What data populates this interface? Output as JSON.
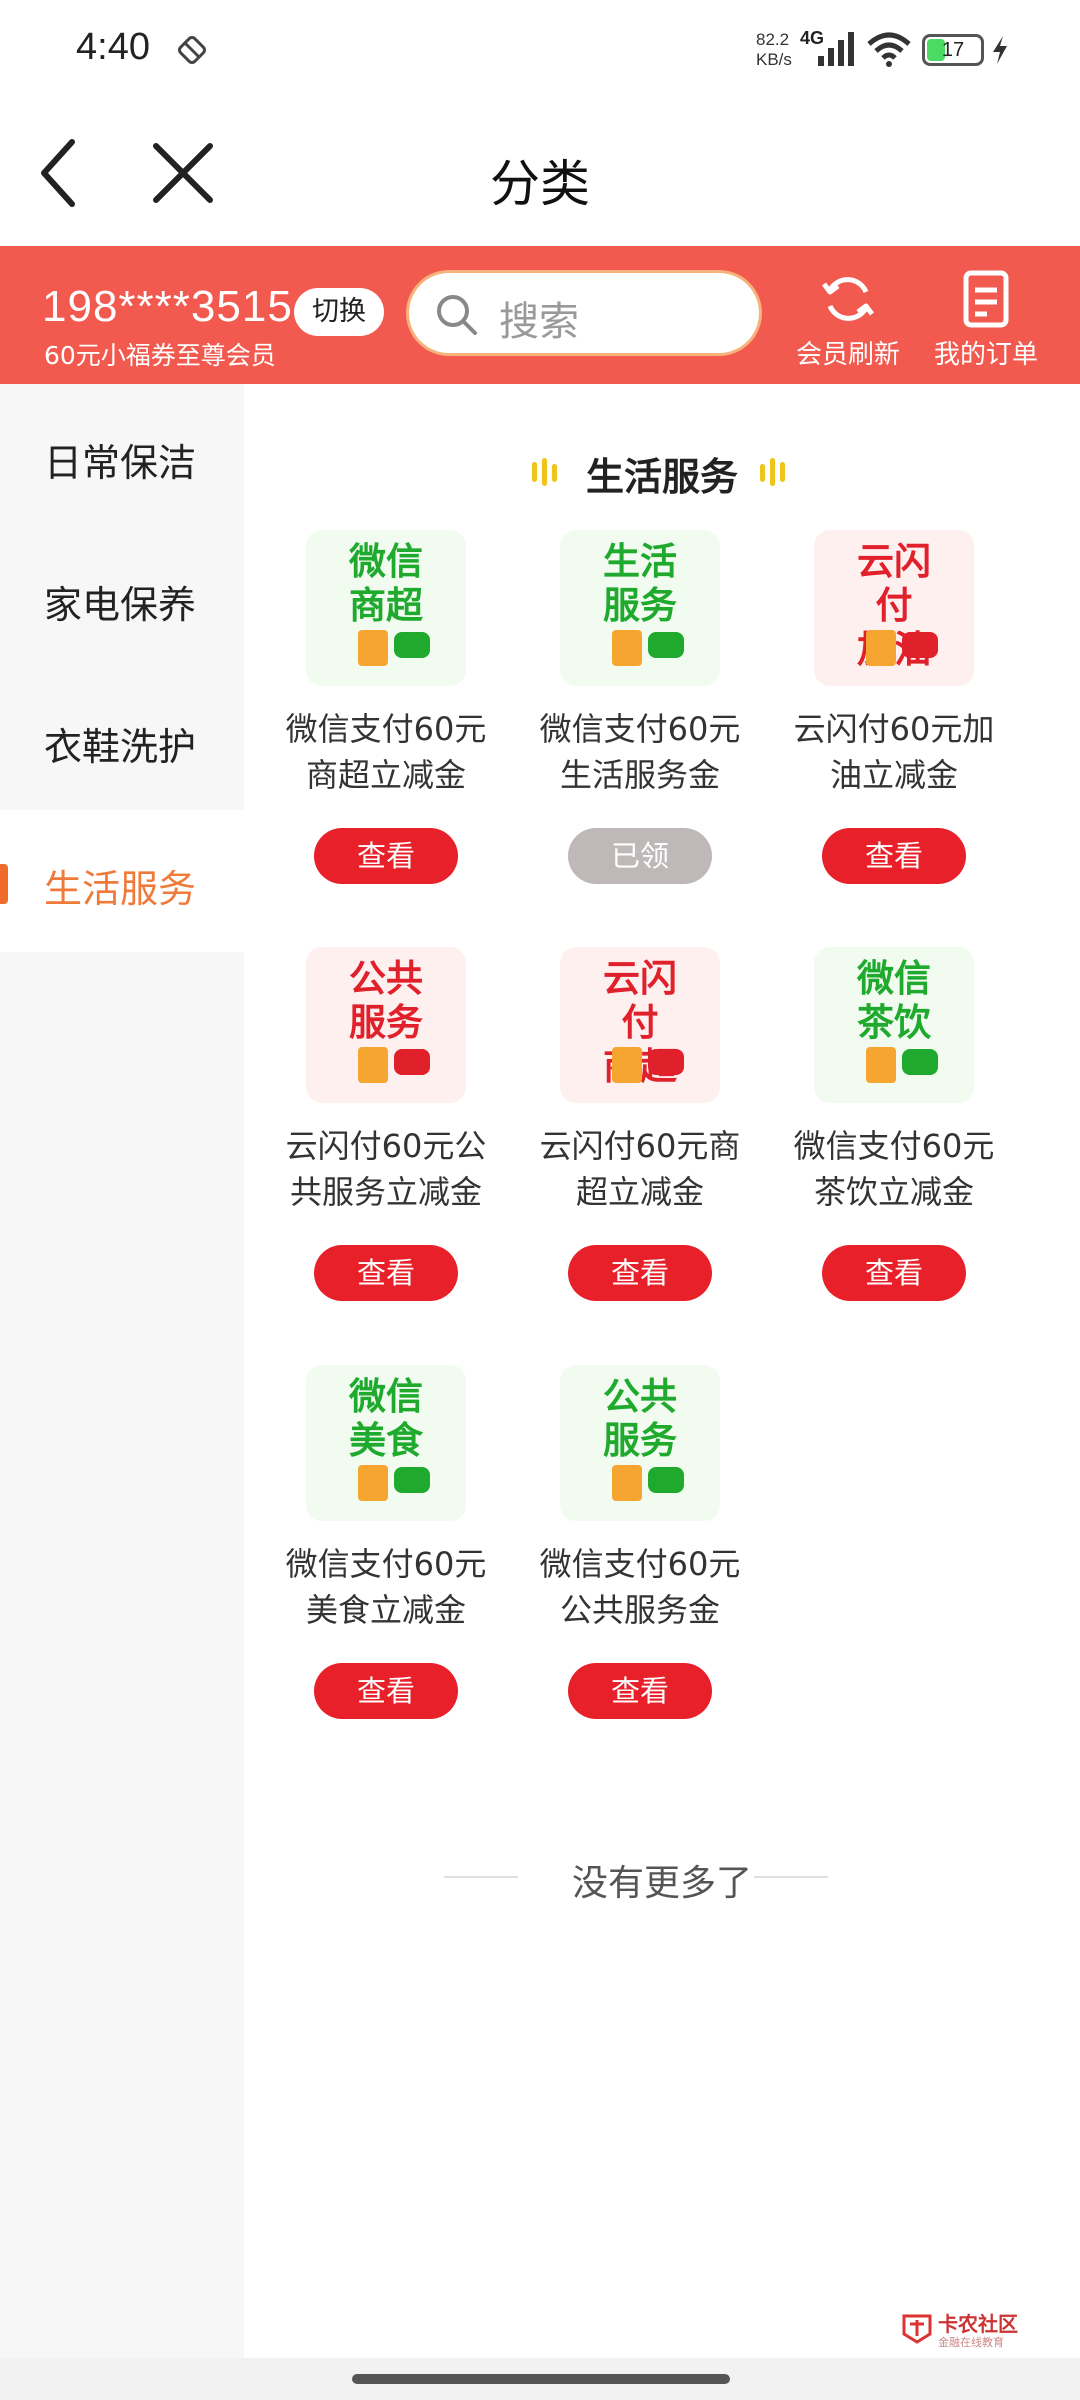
{
  "status_bar": {
    "time": "4:40",
    "speed_value": "82.2",
    "speed_unit": "KB/s",
    "network": "4G",
    "battery": "17"
  },
  "nav": {
    "title": "分类"
  },
  "header": {
    "phone": "198****3515",
    "member_text": "60元小福券至尊会员",
    "switch_label": "切换",
    "search_placeholder": "搜索",
    "refresh_label": "会员刷新",
    "orders_label": "我的订单"
  },
  "sidebar": {
    "items": [
      {
        "label": "日常保洁",
        "active": false
      },
      {
        "label": "家电保养",
        "active": false
      },
      {
        "label": "衣鞋洗护",
        "active": false
      },
      {
        "label": "生活服务",
        "active": true
      }
    ]
  },
  "section": {
    "title": "生活服务"
  },
  "cards": [
    {
      "thumb_text": "微信商超",
      "name": "微信支付60元商超立减金",
      "button": "查看",
      "brand": "wechat"
    },
    {
      "thumb_text": "生活服务",
      "name": "微信支付60元生活服务金",
      "button": "已领",
      "brand": "wechat"
    },
    {
      "thumb_text": "云闪付加油",
      "name": "云闪付60元加油立减金",
      "button": "查看",
      "brand": "unionpay"
    },
    {
      "thumb_text": "公共服务",
      "name": "云闪付60元公共服务立减金",
      "button": "查看",
      "brand": "unionpay"
    },
    {
      "thumb_text": "云闪付商超",
      "name": "云闪付60元商超立减金",
      "button": "查看",
      "brand": "unionpay"
    },
    {
      "thumb_text": "微信茶饮",
      "name": "微信支付60元茶饮立减金",
      "button": "查看",
      "brand": "wechat"
    },
    {
      "thumb_text": "微信美食",
      "name": "微信支付60元美食立减金",
      "button": "查看",
      "brand": "wechat"
    },
    {
      "thumb_text": "公共服务",
      "name": "微信支付60元公共服务金",
      "button": "查看",
      "brand": "wechat"
    }
  ],
  "no_more_text": "没有更多了",
  "watermark": {
    "line1": "卡农社区",
    "line2": "金融在线教育"
  },
  "colors": {
    "header_red": "#f25a50",
    "button_red": "#e8202a",
    "button_claimed": "#bfb8b8",
    "wechat_green": "#1faa2e",
    "unionpay_red": "#e0202a",
    "active_orange": "#f07a3a"
  },
  "icons": {
    "back": "chevron-left-icon",
    "close": "close-icon",
    "search": "search-icon",
    "refresh": "refresh-icon",
    "orders": "document-icon"
  }
}
